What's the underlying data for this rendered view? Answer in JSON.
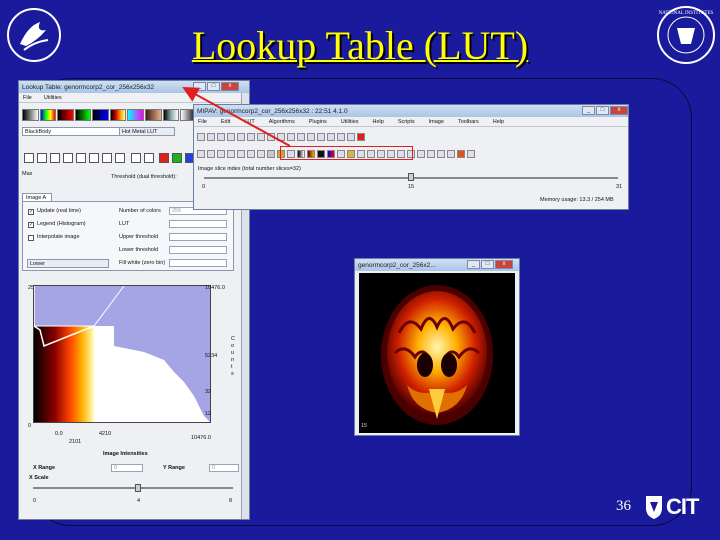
{
  "slide": {
    "title": "Lookup Table (LUT)",
    "page_number": "36",
    "cit_logo_text": "CIT",
    "colors": {
      "background": "#1a1a9c",
      "title": "#ffff00",
      "highlight": "#e02020"
    }
  },
  "lut_window": {
    "title": "Lookup Table:  genormcorp2_cor_256x256x32",
    "menu": [
      "File",
      "Utilities"
    ],
    "colormap_select": "BlackBody",
    "colormap_select_right": "Hot Metal LUT",
    "tab": "Image A",
    "options": [
      {
        "label": "Update (real time)",
        "checked": true
      },
      {
        "label": "Legend (Histogram)",
        "checked": true
      },
      {
        "label": "Interpolate image",
        "checked": false
      }
    ],
    "fields": [
      {
        "label": "Number of colors",
        "value": "256"
      },
      {
        "label": "LUT",
        "value": ""
      },
      {
        "label": "Upper threshold",
        "value": ""
      },
      {
        "label": "Lower threshold",
        "value": ""
      },
      {
        "label": "Fill white (zero bin)",
        "value": ""
      }
    ],
    "max_label": "Max",
    "threshold_label": "Threshold (dual threshold):",
    "lower_select": "Lower",
    "histogram": {
      "y_top_left": "255",
      "y_top_right": "10476.0",
      "y_mid_right": "5234",
      "y_low_right": "32",
      "y_bottom_right": "12",
      "y_bottom_left": "0",
      "x_labels": [
        "0.0",
        "4210",
        "10476.0"
      ],
      "x_sub_label": "2101",
      "xlabel": "Image Intensities",
      "side_label": "C o u n t s"
    },
    "x_range_label": "X Range",
    "x_range_value": "0",
    "y_range_label": "Y Range",
    "y_range_value": "0",
    "x_scale_label": "X Scale",
    "x_scale_ticks": [
      "0",
      "4",
      "8"
    ]
  },
  "main_window": {
    "title": "MIPAV:  genormcorp2_cor_256x256x32 : 22:51  4.1.0",
    "menu": [
      "File",
      "Edit",
      "LUT",
      "Algorithms",
      "Plugins",
      "Utilities",
      "Help",
      "Scripts",
      "Image",
      "Toolbars",
      "Help"
    ],
    "slice_label": "Image slice index (total number slices=32)",
    "slice_ticks": [
      "0",
      "15",
      "31"
    ],
    "memory_text": "Memory usage: 13.3 / 254 MB"
  },
  "image_window": {
    "title": "genormcorp2_cor_256x2...",
    "slice_num": "15"
  }
}
